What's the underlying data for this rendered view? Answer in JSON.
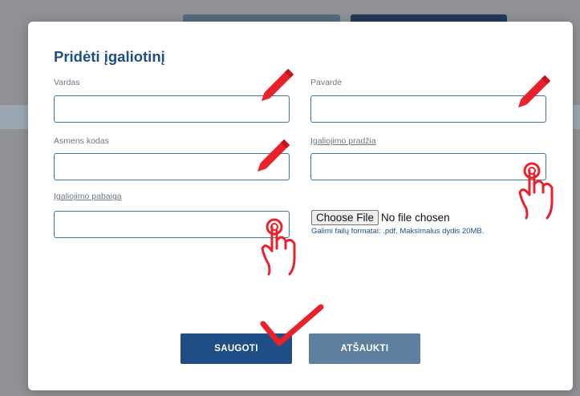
{
  "modal": {
    "title": "Pridėti įgaliotinį"
  },
  "form": {
    "fields": [
      {
        "label": "Vardas",
        "value": "",
        "placeholder": ""
      },
      {
        "label": "Pavardė",
        "value": "",
        "placeholder": ""
      },
      {
        "label": "Asmens kodas",
        "value": "",
        "placeholder": ""
      },
      {
        "label": "Įgaliojimo pradžia",
        "value": "",
        "placeholder": ""
      },
      {
        "label": "Įgaliojimo pabaiga",
        "value": "",
        "placeholder": ""
      }
    ],
    "file": {
      "button_label": "Choose File",
      "status": "No file chosen",
      "hint": "Galimi failų formatai: .pdf. Maksimalus dydis 20MB."
    }
  },
  "buttons": {
    "save_label": "SAUGOTI",
    "cancel_label": "ATŠAUKTI"
  },
  "annotations": {
    "icons": [
      "pencil-icon",
      "pointer-hand-icon",
      "checkmark-icon"
    ],
    "accent_color": "#e8212a"
  },
  "colors": {
    "primary": "#1f4e86",
    "secondary": "#5e7f9e",
    "field_border": "#3f74a8"
  }
}
